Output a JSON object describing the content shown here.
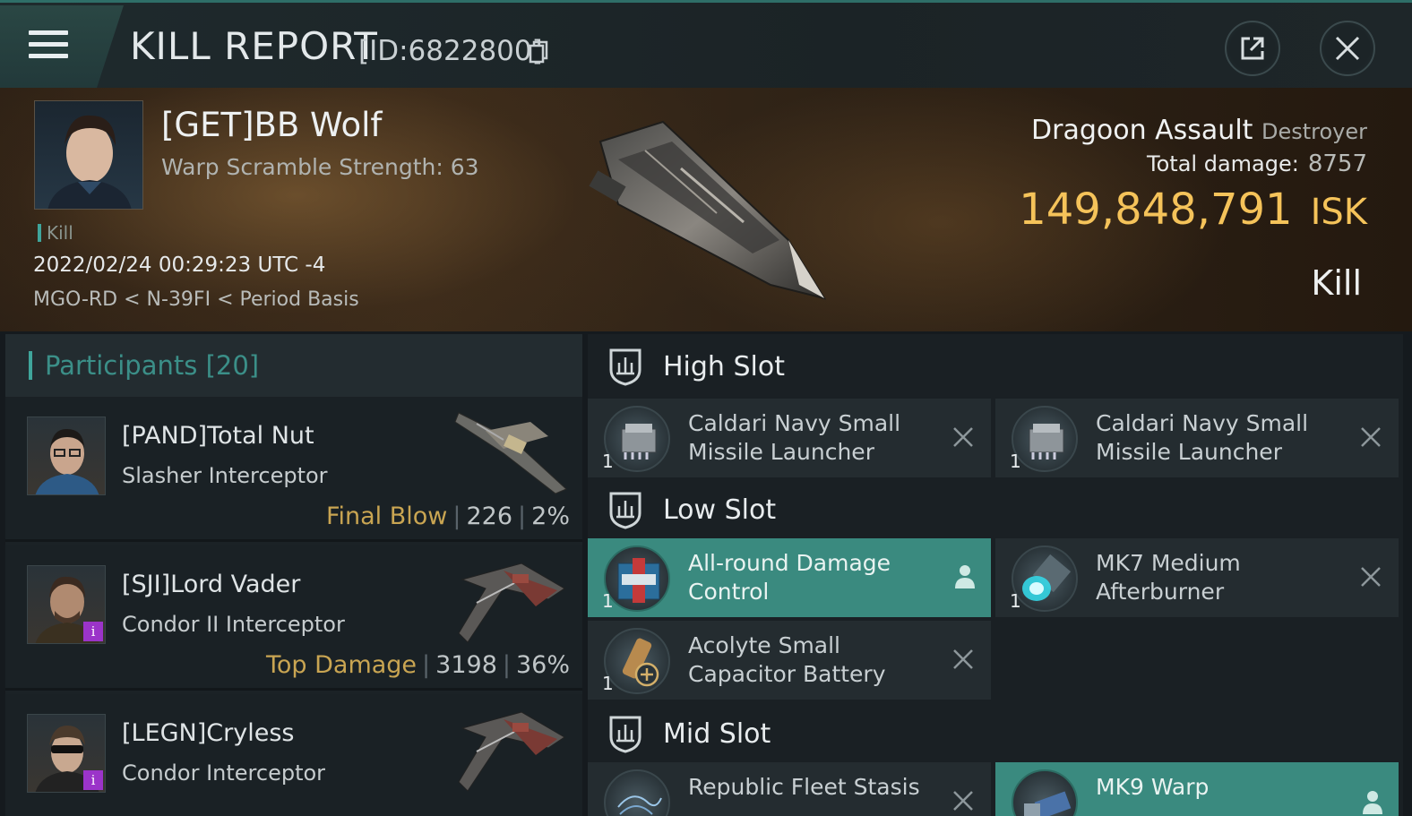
{
  "header": {
    "title": "KILL REPORT",
    "report_id": "[ID:6822800]"
  },
  "victim": {
    "name": "[GET]BB Wolf",
    "subtitle": "Warp Scramble Strength: 63",
    "tag": "Kill",
    "datetime": "2022/02/24 00:29:23 UTC -4",
    "location": "MGO-RD < N-39FI < Period Basis",
    "ship_name": "Dragoon Assault",
    "ship_class": "Destroyer",
    "total_damage_label": "Total damage:",
    "total_damage": "8757",
    "isk_value": "149,848,791",
    "isk_unit": "ISK",
    "result": "Kill"
  },
  "participants": {
    "label": "Participants [20]",
    "rows": [
      {
        "name": "[PAND]Total Nut",
        "ship": "Slasher Interceptor",
        "tag": "Final Blow",
        "damage": "226",
        "percent": "2%"
      },
      {
        "name": "[SJI]Lord Vader",
        "ship": "Condor II Interceptor",
        "tag": "Top Damage",
        "damage": "3198",
        "percent": "36%"
      },
      {
        "name": "[LEGN]Cryless",
        "ship": "Condor Interceptor",
        "tag": "",
        "damage": "",
        "percent": ""
      }
    ]
  },
  "fitting": {
    "high_slot": {
      "label": "High Slot",
      "items": [
        {
          "name": "Caldari Navy Small Missile Launcher",
          "qty": "1"
        },
        {
          "name": "Caldari Navy Small Missile Launcher",
          "qty": "1"
        }
      ]
    },
    "low_slot": {
      "label": "Low Slot",
      "items": [
        {
          "name": "All-round Damage Control",
          "qty": "1"
        },
        {
          "name": "MK7 Medium Afterburner",
          "qty": "1"
        },
        {
          "name": "Acolyte Small Capacitor Battery",
          "qty": "1"
        }
      ]
    },
    "mid_slot": {
      "label": "Mid Slot",
      "items": [
        {
          "name": "Republic Fleet Stasis",
          "qty": ""
        },
        {
          "name": "MK9 Warp",
          "qty": ""
        }
      ]
    }
  },
  "colors": {
    "accent_teal": "#3fa59b",
    "isk_gold": "#f5c35a",
    "tag_gold": "#c9a552",
    "active_item": "#3a8a7f",
    "badge_purple": "#9b34c9"
  },
  "icons": [
    "menu-icon",
    "copy-icon",
    "share-icon",
    "close-icon",
    "shield-icon",
    "remove-x-icon",
    "pilot-icon",
    "info-badge-icon"
  ]
}
